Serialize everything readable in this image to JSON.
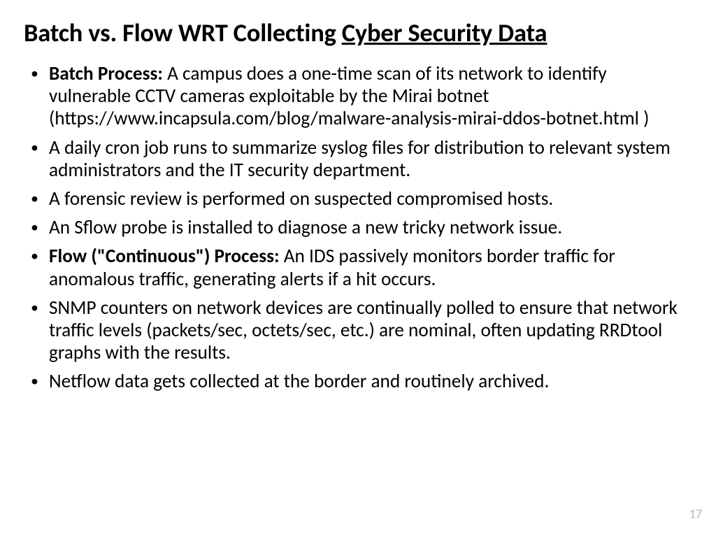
{
  "title": {
    "plain": "Batch vs. Flow WRT Collecting ",
    "underlined": "Cyber Security Data"
  },
  "bullets": [
    {
      "bold": "Batch Process: ",
      "text": "A  campus does a one-time scan of its network to identify vulnerable CCTV cameras exploitable by the Mirai botnet (https://www.incapsula.com/blog/malware-analysis-mirai-ddos-botnet.html )"
    },
    {
      "bold": "",
      "text": "A daily cron job runs to summarize syslog files for distribution to relevant system administrators and the IT security department."
    },
    {
      "bold": "",
      "text": "A forensic review is performed on suspected compromised hosts."
    },
    {
      "bold": "",
      "text": "An Sflow probe is installed to diagnose a new tricky network issue."
    },
    {
      "bold": "Flow (\"Continuous\") Process: ",
      "text": "An IDS passively monitors border traffic for anomalous traffic, generating alerts if a hit occurs."
    },
    {
      "bold": "",
      "text": "SNMP counters on network devices are continually polled to ensure that network traffic levels (packets/sec, octets/sec, etc.) are nominal, often updating RRDtool graphs with the results."
    },
    {
      "bold": "",
      "text": "Netflow data gets collected at the border and routinely archived."
    }
  ],
  "page_number": "17"
}
